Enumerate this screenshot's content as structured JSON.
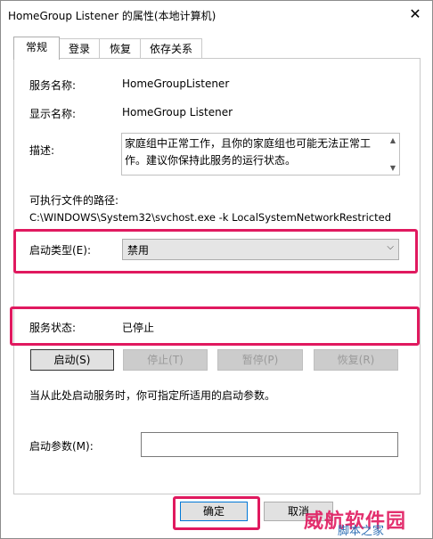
{
  "window": {
    "title": "HomeGroup Listener 的属性(本地计算机)",
    "close_glyph": "✕"
  },
  "tabs": [
    {
      "label": "常规",
      "active": true
    },
    {
      "label": "登录",
      "active": false
    },
    {
      "label": "恢复",
      "active": false
    },
    {
      "label": "依存关系",
      "active": false
    }
  ],
  "general": {
    "service_name_label": "服务名称:",
    "service_name": "HomeGroupListener",
    "display_name_label": "显示名称:",
    "display_name": "HomeGroup Listener",
    "description_label": "描述:",
    "description": "家庭组中正常工作，且你的家庭组也可能无法正常工作。建议你保持此服务的运行状态。",
    "path_label": "可执行文件的路径:",
    "path": "C:\\WINDOWS\\System32\\svchost.exe -k LocalSystemNetworkRestricted",
    "startup_type_label": "启动类型(E):",
    "startup_type_value": "禁用",
    "service_status_label": "服务状态:",
    "service_status_value": "已停止",
    "hint": "当从此处启动服务时，你可指定所适用的启动参数。",
    "start_params_label": "启动参数(M):",
    "start_params_value": ""
  },
  "service_buttons": {
    "start": "启动(S)",
    "stop": "停止(T)",
    "pause": "暂停(P)",
    "resume": "恢复(R)"
  },
  "footer": {
    "ok": "确定",
    "cancel": "取消"
  },
  "watermark": {
    "line1": "威航软件园",
    "line2": "脚本之家"
  },
  "colors": {
    "highlight": "#e0195f",
    "accent": "#0078d7"
  },
  "icons": {
    "close": "close-icon",
    "dropdown": "chevron-down-icon"
  }
}
